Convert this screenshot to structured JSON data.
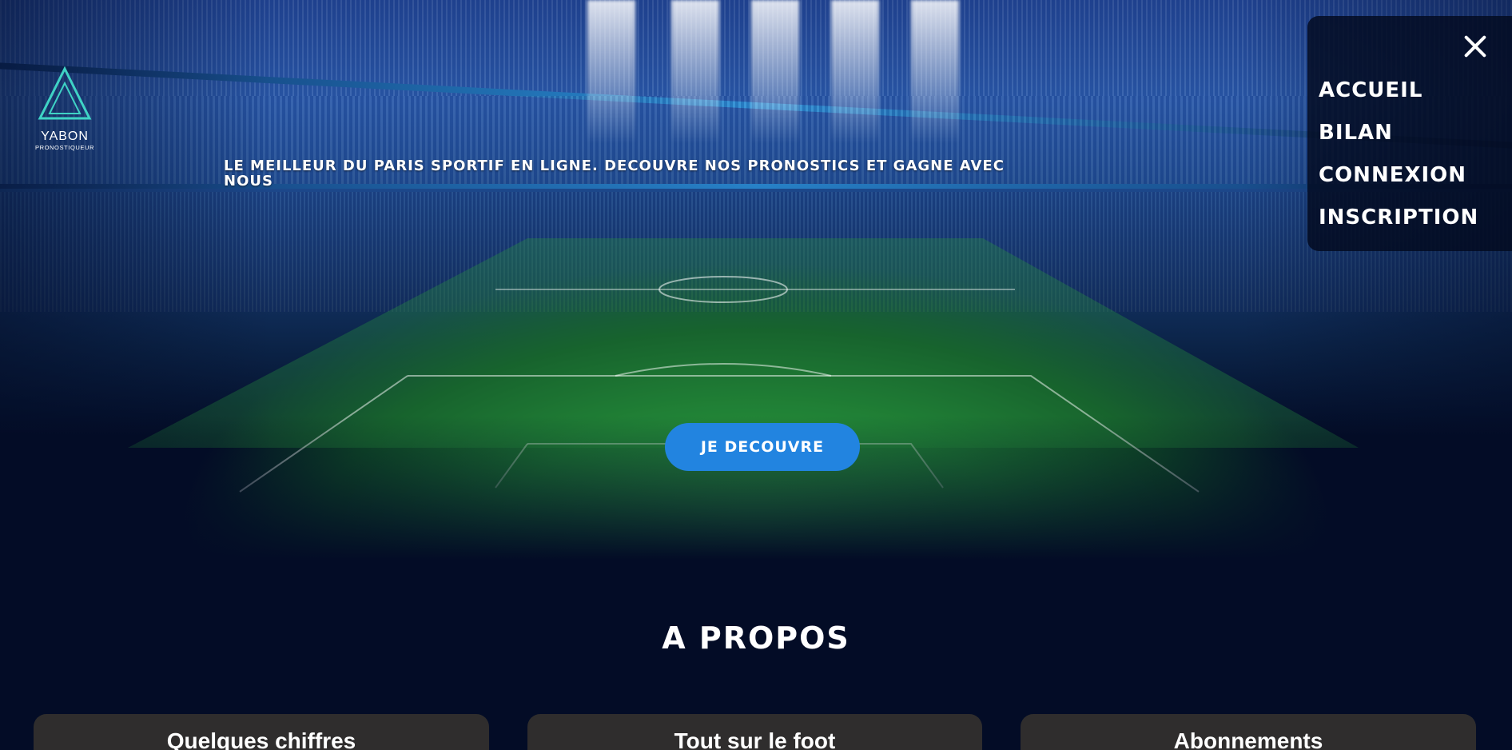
{
  "brand": {
    "name": "YABON",
    "subtitle": "PRONOSTIQUEUR"
  },
  "hero": {
    "tagline": "Le meilleur du paris sportif en ligne. Decouvre nos pronostics et gagne avec nous",
    "cta_label": "Je decouvre"
  },
  "menu": {
    "items": [
      {
        "label": "ACCUEIL"
      },
      {
        "label": "BILAN"
      },
      {
        "label": "CONNEXION"
      },
      {
        "label": "INSCRIPTION"
      }
    ]
  },
  "about": {
    "title": "A PROPOS",
    "cards": [
      {
        "title": "Quelques chiffres"
      },
      {
        "title": "Tout sur le foot"
      },
      {
        "title": "Abonnements"
      }
    ]
  },
  "colors": {
    "background": "#030c26",
    "accent": "#2284e0",
    "card": "#2f2d2d"
  }
}
